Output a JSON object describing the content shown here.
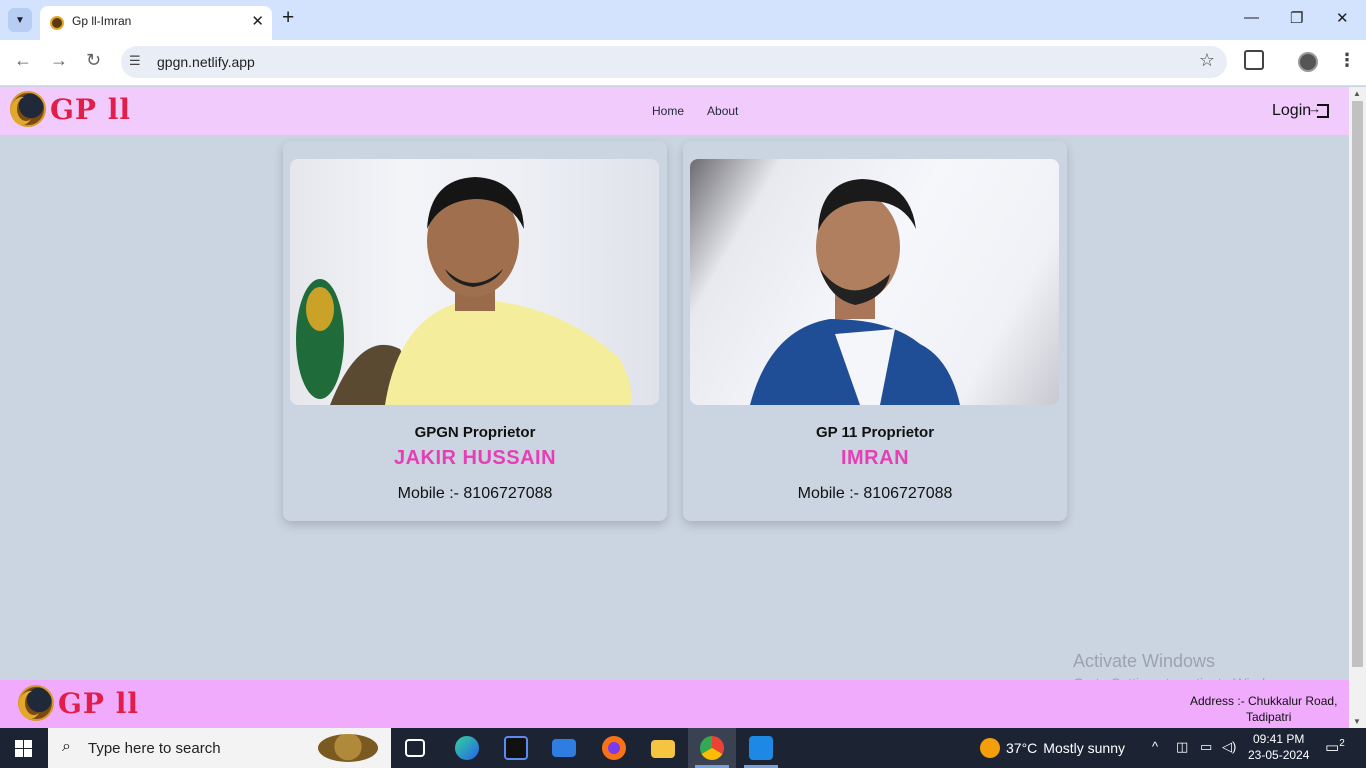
{
  "browser": {
    "tab_title": "Gp ll-Imran",
    "url": "gpgn.netlify.app",
    "tab_close": "✕",
    "new_tab": "+",
    "minimize": "—",
    "restore": "❐",
    "close": "✕"
  },
  "site": {
    "logo_text": "GP ll",
    "nav": [
      "Home",
      "About"
    ],
    "login_label": "Login"
  },
  "cards": [
    {
      "role": "GPGN Proprietor",
      "name": "JAKIR HUSSAIN",
      "mobile": "Mobile :- 8106727088"
    },
    {
      "role": "GP 11 Proprietor",
      "name": "IMRAN",
      "mobile": "Mobile :- 8106727088"
    }
  ],
  "footer": {
    "logo_text": "GP ll",
    "address_line1": "Address :- Chukkalur Road,",
    "address_line2": "Tadipatri"
  },
  "watermark": {
    "line1": "Activate Windows",
    "line2": "Go to Settings to activate Windows."
  },
  "taskbar": {
    "search_placeholder": "Type here to search",
    "weather_temp": "37°C",
    "weather_text": "Mostly sunny",
    "time": "09:41 PM",
    "date": "23-05-2024",
    "notification_count": "2"
  },
  "colors": {
    "header_bg": "#f2cbfd",
    "footer_bg": "#f0abfc",
    "page_bg": "#cbd5e1",
    "logo_red": "#e11d48",
    "name_pink": "#e63fb5"
  }
}
